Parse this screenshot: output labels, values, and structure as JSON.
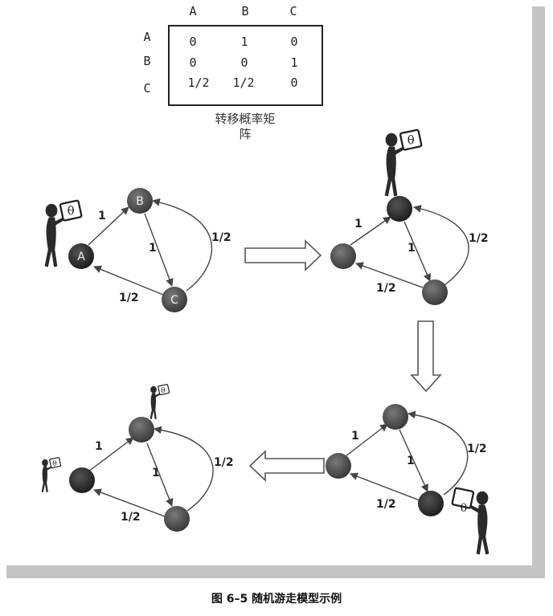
{
  "matrix": {
    "col_headers": [
      "A",
      "B",
      "C"
    ],
    "row_headers": [
      "A",
      "B",
      "C"
    ],
    "rows": [
      [
        "0",
        "1",
        "0"
      ],
      [
        "0",
        "0",
        "1"
      ],
      [
        "1/2",
        "1/2",
        "0"
      ]
    ],
    "caption_line1": "转移概率矩",
    "caption_line2": "阵"
  },
  "graph_initial": {
    "nodes": {
      "a": "A",
      "b": "B",
      "c": "C"
    },
    "edges": {
      "a_to_b": "1",
      "b_to_c": "1",
      "c_to_b": "1/2",
      "c_to_a": "1/2"
    }
  },
  "graph_step1": {
    "edges": {
      "a_to_b": "1",
      "b_to_c": "1",
      "c_to_b": "1/2",
      "c_to_a": "1/2"
    }
  },
  "graph_step2": {
    "edges": {
      "a_to_b": "1",
      "b_to_c": "1",
      "c_to_b": "1/2",
      "c_to_a": "1/2"
    }
  },
  "graph_step3": {
    "edges": {
      "a_to_b": "1",
      "b_to_c": "1",
      "c_to_b": "1/2",
      "c_to_a": "1/2"
    }
  },
  "walker_symbol": "θ",
  "figure_caption": "图 6–5   随机游走模型示例",
  "colors": {
    "node_fill": "#555555",
    "node_fill_dark": "#333333",
    "frame_shadow": "#bdbdbd",
    "edge": "#444444"
  }
}
